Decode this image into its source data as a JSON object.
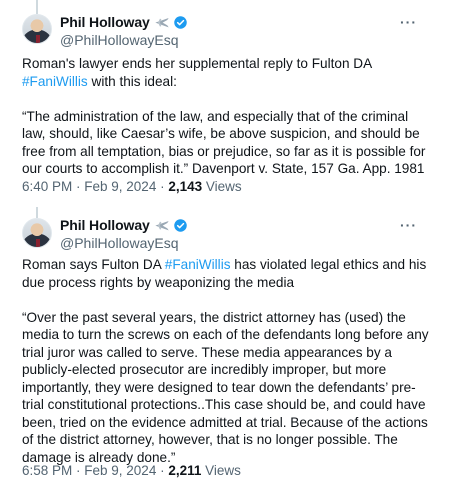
{
  "tweets": [
    {
      "author": {
        "name": "Phil Holloway",
        "handle": "@PhilHollowayEsq",
        "badge_icons": [
          "airplane-icon",
          "verified-icon"
        ]
      },
      "text_before_hashtag": "Roman's lawyer ends her supplemental reply to Fulton DA ",
      "hashtag": "#FaniWillis",
      "text_after_hashtag": " with this ideal:",
      "quote": "“The administration of the law, and especially that of the criminal law, should, like Caesar’s wife, be above suspicion, and should be free from all temptation, bias or prejudice, so far as it is possible for our courts to accomplish it.” Davenport v. State, 157 Ga. App. 1981",
      "time": "6:40 PM · Feb 9, 2024 · ",
      "views_count": "2,143",
      "views_label": " Views"
    },
    {
      "author": {
        "name": "Phil Holloway",
        "handle": "@PhilHollowayEsq",
        "badge_icons": [
          "airplane-icon",
          "verified-icon"
        ]
      },
      "text_before_hashtag": "Roman says Fulton DA ",
      "hashtag": "#FaniWillis",
      "text_after_hashtag": " has violated legal ethics and his due process rights by weaponizing the media",
      "quote": "“Over the past several years, the district attorney has (used) the media to turn the screws on each of the defendants long before any trial juror was called to serve. These media appearances by a publicly-elected prosecutor are incredibly improper, but more importantly, they were designed to tear down the defendants’ pre-trial constitutional protections..This case should be, and could have been, tried on the evidence admitted at trial. Because of the actions of the district attorney, however, that is no longer possible. The damage is already done.”",
      "time": "6:58 PM · Feb 9, 2024 · ",
      "views_count": "2,211",
      "views_label": " Views"
    }
  ],
  "more_label": "···",
  "colors": {
    "hashtag": "#1d9bf0",
    "secondary": "#536471",
    "verified": "#1d9bf0"
  }
}
